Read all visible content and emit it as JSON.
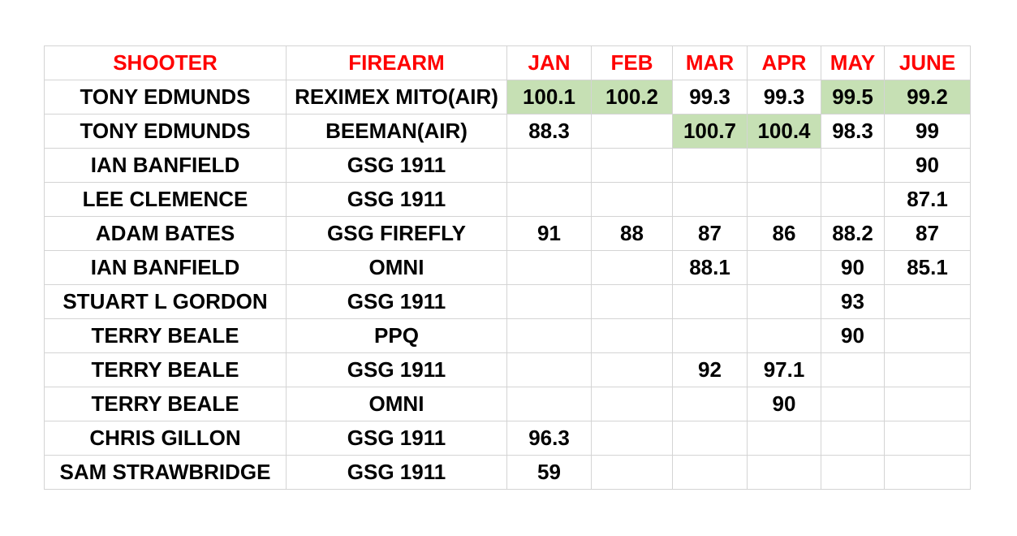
{
  "colors": {
    "header_text": "#ff0000",
    "highlight": "#c6e0b4",
    "grid": "#d4d4d4"
  },
  "headers": [
    "SHOOTER",
    "FIREARM",
    "JAN",
    "FEB",
    "MAR",
    "APR",
    "MAY",
    "JUNE"
  ],
  "rows": [
    {
      "shooter": "TONY EDMUNDS",
      "firearm": "REXIMEX MITO(AIR)",
      "jan": "100.1",
      "feb": "100.2",
      "mar": "99.3",
      "apr": "99.3",
      "may": "99.5",
      "june": "99.2",
      "highlight": [
        "jan",
        "feb",
        "may",
        "june"
      ]
    },
    {
      "shooter": "TONY EDMUNDS",
      "firearm": "BEEMAN(AIR)",
      "jan": "88.3",
      "feb": "",
      "mar": "100.7",
      "apr": "100.4",
      "may": "98.3",
      "june": "99",
      "highlight": [
        "mar",
        "apr"
      ]
    },
    {
      "shooter": "IAN BANFIELD",
      "firearm": "GSG 1911",
      "jan": "",
      "feb": "",
      "mar": "",
      "apr": "",
      "may": "",
      "june": "90",
      "highlight": []
    },
    {
      "shooter": "LEE CLEMENCE",
      "firearm": "GSG 1911",
      "jan": "",
      "feb": "",
      "mar": "",
      "apr": "",
      "may": "",
      "june": "87.1",
      "highlight": []
    },
    {
      "shooter": "ADAM BATES",
      "firearm": "GSG FIREFLY",
      "jan": "91",
      "feb": "88",
      "mar": "87",
      "apr": "86",
      "may": "88.2",
      "june": "87",
      "highlight": []
    },
    {
      "shooter": "IAN BANFIELD",
      "firearm": "OMNI",
      "jan": "",
      "feb": "",
      "mar": "88.1",
      "apr": "",
      "may": "90",
      "june": "85.1",
      "highlight": []
    },
    {
      "shooter": "STUART L GORDON",
      "firearm": "GSG 1911",
      "jan": "",
      "feb": "",
      "mar": "",
      "apr": "",
      "may": "93",
      "june": "",
      "highlight": []
    },
    {
      "shooter": "TERRY BEALE",
      "firearm": "PPQ",
      "jan": "",
      "feb": "",
      "mar": "",
      "apr": "",
      "may": "90",
      "june": "",
      "highlight": []
    },
    {
      "shooter": "TERRY BEALE",
      "firearm": "GSG 1911",
      "jan": "",
      "feb": "",
      "mar": "92",
      "apr": "97.1",
      "may": "",
      "june": "",
      "highlight": []
    },
    {
      "shooter": "TERRY BEALE",
      "firearm": "OMNI",
      "jan": "",
      "feb": "",
      "mar": "",
      "apr": "90",
      "may": "",
      "june": "",
      "highlight": []
    },
    {
      "shooter": "CHRIS GILLON",
      "firearm": "GSG 1911",
      "jan": "96.3",
      "feb": "",
      "mar": "",
      "apr": "",
      "may": "",
      "june": "",
      "highlight": []
    },
    {
      "shooter": "SAM STRAWBRIDGE",
      "firearm": "GSG 1911",
      "jan": "59",
      "feb": "",
      "mar": "",
      "apr": "",
      "may": "",
      "june": "",
      "highlight": []
    }
  ]
}
